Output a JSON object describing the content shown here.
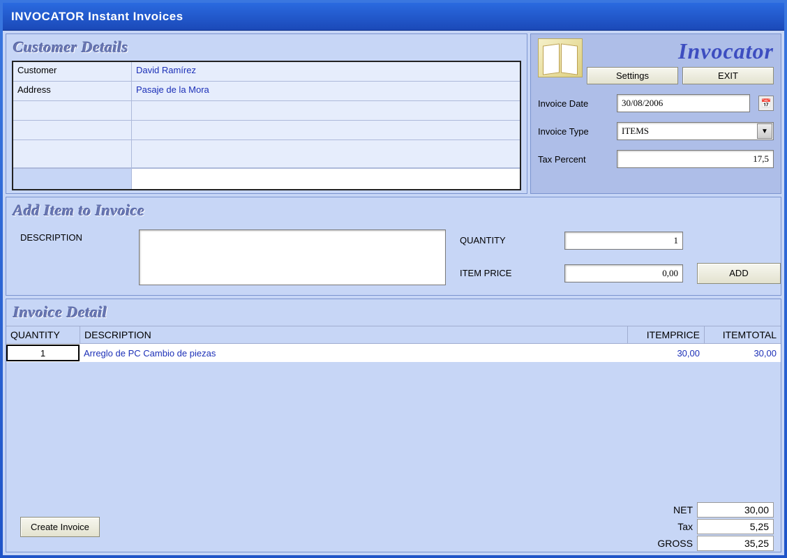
{
  "window_title": "INVOCATOR Instant Invoices",
  "brand": "Invocator",
  "customer": {
    "section_title": "Customer Details",
    "labels": {
      "customer": "Customer",
      "address": "Address"
    },
    "name": "David Ramírez",
    "address": "Pasaje de la Mora"
  },
  "right": {
    "settings_btn": "Settings",
    "exit_btn": "EXIT",
    "invoice_date_label": "Invoice Date",
    "invoice_date": "30/08/2006",
    "invoice_type_label": "Invoice Type",
    "invoice_type": "ITEMS",
    "tax_percent_label": "Tax Percent",
    "tax_percent": "17,5"
  },
  "additem": {
    "section_title": "Add Item to Invoice",
    "description_label": "DESCRIPTION",
    "quantity_label": "QUANTITY",
    "quantity_value": "1",
    "price_label": "ITEM PRICE",
    "price_value": "0,00",
    "add_btn": "ADD"
  },
  "detail": {
    "section_title": "Invoice Detail",
    "headers": {
      "qty": "QUANTITY",
      "desc": "DESCRIPTION",
      "price": "ITEMPRICE",
      "total": "ITEMTOTAL"
    },
    "rows": [
      {
        "qty": "1",
        "desc": "Arreglo de PC Cambio de piezas",
        "price": "30,00",
        "total": "30,00"
      }
    ],
    "create_btn": "Create Invoice",
    "totals": {
      "net_label": "NET",
      "net": "30,00",
      "tax_label": "Tax",
      "tax": "5,25",
      "gross_label": "GROSS",
      "gross": "35,25"
    }
  }
}
